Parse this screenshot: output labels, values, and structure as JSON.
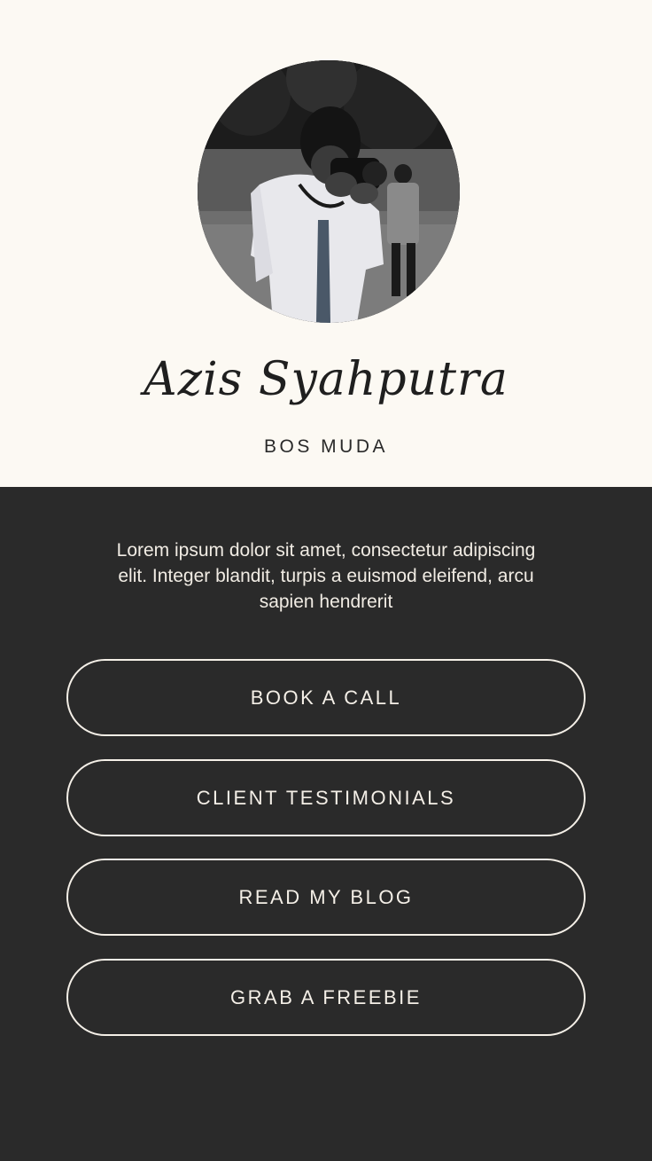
{
  "profile": {
    "name": "Azis Syahputra",
    "role": "BOS MUDA",
    "avatar_icon": "profile-photo"
  },
  "bio": {
    "text": "Lorem ipsum dolor sit amet, consectetur adipiscing elit. Integer blandit, turpis a euismod eleifend, arcu sapien hendrerit"
  },
  "links": [
    {
      "label": "BOOK A CALL"
    },
    {
      "label": "CLIENT TESTIMONIALS"
    },
    {
      "label": "READ MY BLOG"
    },
    {
      "label": "GRAB A FREEBIE"
    }
  ],
  "colors": {
    "top_background": "#fcf9f3",
    "bottom_background": "#2a2a2a",
    "text_light": "#f4efe7",
    "text_dark": "#1f1f1f"
  }
}
